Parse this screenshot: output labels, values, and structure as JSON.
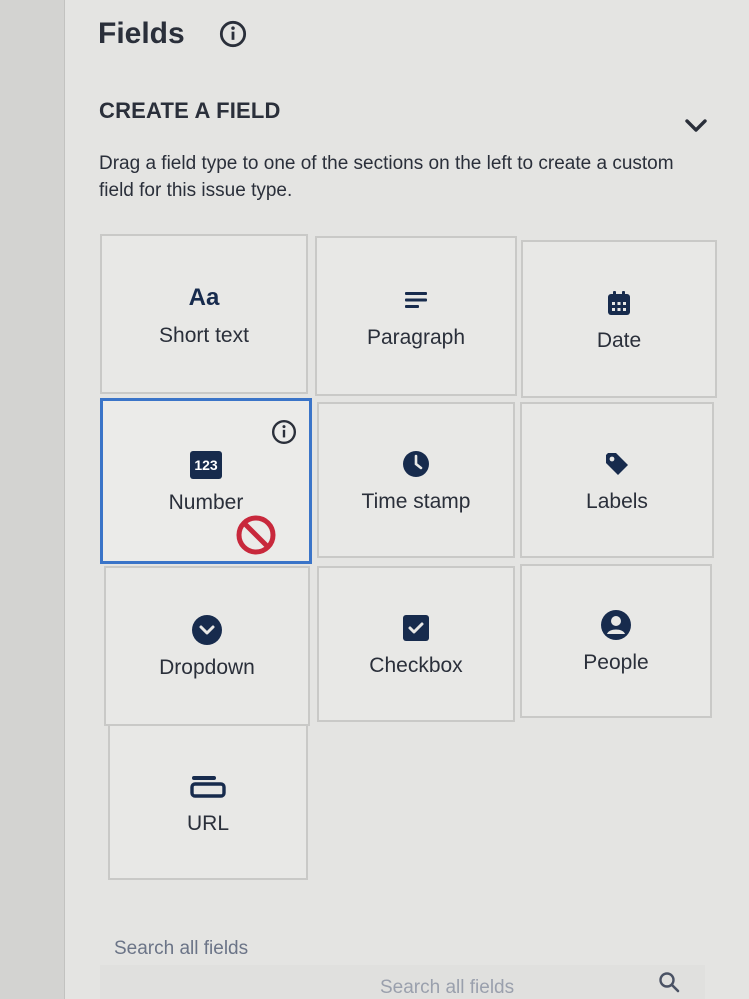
{
  "panel": {
    "title": "Fields",
    "section_title": "CREATE A FIELD",
    "description": "Drag a field type to one of the sections on the left to create a custom field for this issue type."
  },
  "fields": [
    {
      "label": "Short text",
      "icon": "short-text-icon",
      "glyph": "Aa"
    },
    {
      "label": "Paragraph",
      "icon": "paragraph-icon"
    },
    {
      "label": "Date",
      "icon": "calendar-icon"
    },
    {
      "label": "Number",
      "icon": "number-icon",
      "glyph": "123",
      "selected": true
    },
    {
      "label": "Time stamp",
      "icon": "clock-icon"
    },
    {
      "label": "Labels",
      "icon": "tag-icon"
    },
    {
      "label": "Dropdown",
      "icon": "dropdown-icon"
    },
    {
      "label": "Checkbox",
      "icon": "checkbox-icon"
    },
    {
      "label": "People",
      "icon": "person-icon"
    },
    {
      "label": "URL",
      "icon": "url-icon"
    }
  ],
  "search": {
    "label": "Search all fields",
    "placeholder": "Search all fields"
  },
  "colors": {
    "selected_border": "#3a74c8",
    "no_drop": "#c8283c",
    "icon": "#172b4d"
  }
}
